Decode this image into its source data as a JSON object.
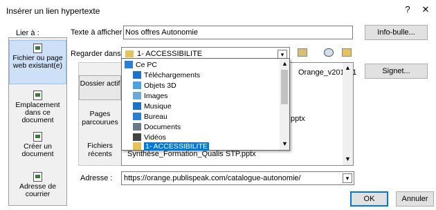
{
  "dialog": {
    "title": "Insérer un lien hypertexte",
    "help": "?",
    "close": "✕"
  },
  "link_to_label": "Lier à :",
  "sidebar": {
    "items": [
      {
        "label": "Fichier ou page web existant(e)"
      },
      {
        "label": "Emplacement dans ce document"
      },
      {
        "label": "Créer un document"
      },
      {
        "label": "Adresse de courrier"
      }
    ]
  },
  "display_text": {
    "label": "Texte à afficher :",
    "value": "Nos offres Autonomie"
  },
  "screentip_button": "Info-bulle...",
  "look_in": {
    "label": "Regarder dans :",
    "value": "1- ACCESSIBILITE"
  },
  "bookmark_button": "Signet...",
  "left_tabs": [
    {
      "label": "Dossier actif"
    },
    {
      "label": "Pages parcourues"
    },
    {
      "label": "Fichiers récents"
    }
  ],
  "file_list": {
    "visible_fragments": [
      "Orange_v201911",
      "pptx",
      "Synthèse_Formation_Qualis STP.pptx"
    ]
  },
  "dropdown": {
    "items": [
      {
        "label": "Ce PC",
        "icon": "pc-icon",
        "color": "#2a7fd4"
      },
      {
        "label": "Téléchargements",
        "icon": "download-icon",
        "color": "#1e73c8"
      },
      {
        "label": "Objets 3D",
        "icon": "cube-icon",
        "color": "#4aa3df"
      },
      {
        "label": "Images",
        "icon": "image-icon",
        "color": "#6aa9d8"
      },
      {
        "label": "Musique",
        "icon": "music-icon",
        "color": "#1e73c8"
      },
      {
        "label": "Bureau",
        "icon": "desktop-icon",
        "color": "#2a7fd4"
      },
      {
        "label": "Documents",
        "icon": "documents-icon",
        "color": "#6a7a8a"
      },
      {
        "label": "Vidéos",
        "icon": "video-icon",
        "color": "#444"
      },
      {
        "label": "1- ACCESSIBILITE",
        "icon": "folder-icon",
        "color": "#e8c15a"
      }
    ]
  },
  "address": {
    "label": "Adresse :",
    "value": "https://orange.publispeak.com/catalogue-autonomie/"
  },
  "ok_button": "OK",
  "cancel_button": "Annuler"
}
